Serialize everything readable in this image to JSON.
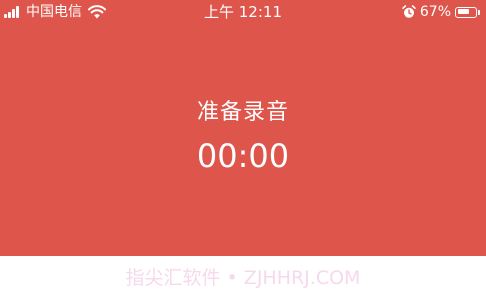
{
  "colors": {
    "panel_background": "#de554b",
    "foreground": "#ffffff",
    "watermark": "#f6d9ec"
  },
  "status_bar": {
    "carrier": "中国电信",
    "time": "上午 12:11",
    "battery_percent": "67%",
    "battery_level": 0.67,
    "signal_bars": 4,
    "icons": [
      "signal-icon",
      "wifi-icon",
      "alarm-icon",
      "battery-icon"
    ]
  },
  "recorder": {
    "title": "准备录音",
    "timer": "00:00"
  },
  "watermark": "指尖汇软件 • ZJHHRJ.COM"
}
